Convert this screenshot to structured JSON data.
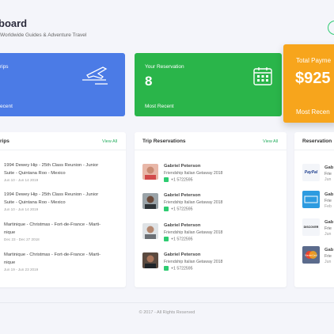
{
  "header": {
    "title": "board",
    "subtitle": "Worldwide Guides & Adventure Travel"
  },
  "stats": [
    {
      "label": "rips",
      "value": "",
      "footer": "ecent",
      "color": "#4b7be6"
    },
    {
      "label": "Your Reservation",
      "value": "8",
      "footer": "Most Recent",
      "color": "#2ab54a"
    },
    {
      "label": "Total Payme",
      "value": "$925",
      "footer": "Most Recen",
      "color": "#f7a51c"
    }
  ],
  "trips": {
    "title": "rips",
    "link": "View All",
    "items": [
      {
        "l1": "1994 Dewey Hip - 25th Class Reunion - Junior",
        "l2": "Suite - Quintana Roo - Mexico",
        "date": "Jun 10 - Jun 14 2019"
      },
      {
        "l1": "1994 Dewey Hip - 25th Class Reunion - Junior",
        "l2": "Suite - Quintana Roo - Mexico",
        "date": "Jun 10 - Jun 14 2019"
      },
      {
        "l1": "Martinique - Christmas - Fort-de-France - Marti-",
        "l2": "nique",
        "date": "Dec 23 - Dec 27 2018"
      },
      {
        "l1": "Martinique - Christmas - Fort-de-France - Marti-",
        "l2": "nique",
        "date": "Jun 19 - Jun 23 2019"
      }
    ]
  },
  "reservations": {
    "title": "Trip Reservations",
    "link": "View All",
    "items": [
      {
        "name": "Gabriel Peterson",
        "event": "Friendship Italian Getaway 2018",
        "phone": "+1 5722595"
      },
      {
        "name": "Gabriel Peterson",
        "event": "Friendship Italian Getaway 2018",
        "phone": "+1 5722595"
      },
      {
        "name": "Gabriel Peterson",
        "event": "Friendship Italian Getaway 2018",
        "phone": "+1 5722595"
      },
      {
        "name": "Gabriel Peterson",
        "event": "Friendship Italian Getaway 2018",
        "phone": "+1 5722595"
      }
    ]
  },
  "payments": {
    "title": "Reservation",
    "items": [
      {
        "name": "Gab",
        "sub": "Frie",
        "date": "Jun",
        "brand": "PayPal",
        "color": "#f3f5f9"
      },
      {
        "name": "Gab",
        "sub": "Frie",
        "date": "Feb",
        "brand": "",
        "color": "#2d9be0"
      },
      {
        "name": "Gab",
        "sub": "Frie",
        "date": "Jun",
        "brand": "DISCOVER",
        "color": "#f3f5f9"
      },
      {
        "name": "Gab",
        "sub": "Frie",
        "date": "Jun",
        "brand": "MasterCard",
        "color": "#5b6b8c"
      }
    ]
  },
  "footer": {
    "copyright": "© 2017 - All Rights Reserved"
  }
}
